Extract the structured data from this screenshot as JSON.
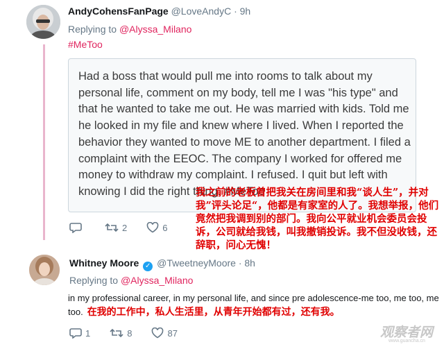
{
  "tweet1": {
    "name": "AndyCohensFanPage",
    "handle": "@LoveAndyC",
    "time": "· 9h",
    "replying_label": "Replying to",
    "replying_to": "@Alyssa_Milano",
    "hashtag": "#MeToo",
    "card_text": "Had a boss that would pull me into rooms to talk about my personal life, comment on my body, tell me I was \"his type\" and that he wanted to take me out. He was married with kids. Told me he looked in my file and knew where I lived. When I reported the behavior they wanted to move ME to another department. I filed a complaint with the EEOC. The company I worked for offered me money to withdraw my complaint. I refused. I quit but left with knowing I did the right thing. #MeToo",
    "translation_overlay": "我之前的老板曾把我关在房间里和我“谈人生”，并对我”评头论足“，他都是有家室的人了。我想举报，他们竟然把我调到别的部门。我向公平就业机会委员会投诉，公司就给我钱，叫我撤销投诉。我不但没收钱，还辞职，问心无愧！",
    "actions": {
      "reply_count": "",
      "retweet_count": "2",
      "like_count": "6"
    }
  },
  "tweet2": {
    "name": "Whitney Moore",
    "handle": "@TweetneyMoore",
    "time": "· 8h",
    "replying_label": "Replying to",
    "replying_to": "@Alyssa_Milano",
    "text": "in my professional career, in my personal life, and since pre adolescence-me too, me too, me too.",
    "translation_inline": "在我的工作中，私人生活里，从青年开始都有过，还有我。",
    "actions": {
      "reply_count": "1",
      "retweet_count": "8",
      "like_count": "87"
    }
  },
  "watermark": {
    "text": "观察者网",
    "url": "www.guancha.cn"
  },
  "colors": {
    "accent_pink": "#e0245e",
    "thread_line": "#e9b5cd",
    "verified_blue": "#1da1f2",
    "overlay_red": "#e00000"
  },
  "icons": [
    "reply-icon",
    "retweet-icon",
    "like-icon",
    "verified-icon"
  ]
}
